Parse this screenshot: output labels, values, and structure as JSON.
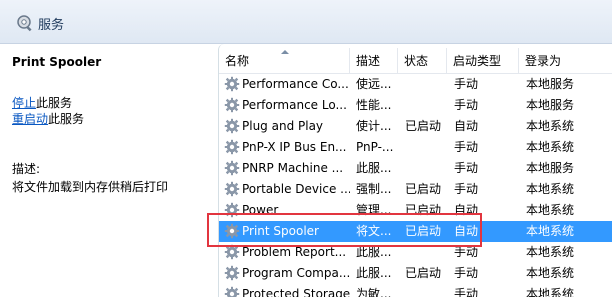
{
  "header": {
    "title": "服务"
  },
  "detail": {
    "service_name": "Print Spooler",
    "stop_link": "停止",
    "stop_suffix": "此服务",
    "restart_link": "重启动",
    "restart_suffix": "此服务",
    "description_label": "描述:",
    "description_text": "将文件加载到内存供稍后打印"
  },
  "columns": {
    "name": "名称",
    "description": "描述",
    "status": "状态",
    "startup_type": "启动类型",
    "logon_as": "登录为"
  },
  "rows": [
    {
      "name": "Performance Co...",
      "description": "使远...",
      "status": "",
      "startup": "手动",
      "logon": "本地服务",
      "selected": false
    },
    {
      "name": "Performance Lo...",
      "description": "性能...",
      "status": "",
      "startup": "手动",
      "logon": "本地服务",
      "selected": false
    },
    {
      "name": "Plug and Play",
      "description": "使计...",
      "status": "已启动",
      "startup": "自动",
      "logon": "本地系统",
      "selected": false
    },
    {
      "name": "PnP-X IP Bus En...",
      "description": "PnP-...",
      "status": "",
      "startup": "手动",
      "logon": "本地系统",
      "selected": false
    },
    {
      "name": "PNRP Machine ...",
      "description": "此服...",
      "status": "",
      "startup": "手动",
      "logon": "本地服务",
      "selected": false
    },
    {
      "name": "Portable Device ...",
      "description": "强制...",
      "status": "已启动",
      "startup": "手动",
      "logon": "本地系统",
      "selected": false
    },
    {
      "name": "Power",
      "description": "管理...",
      "status": "已启动",
      "startup": "自动",
      "logon": "本地系统",
      "selected": false
    },
    {
      "name": "Print Spooler",
      "description": "将文...",
      "status": "已启动",
      "startup": "自动",
      "logon": "本地系统",
      "selected": true
    },
    {
      "name": "Problem Report...",
      "description": "此服...",
      "status": "",
      "startup": "手动",
      "logon": "本地系统",
      "selected": false
    },
    {
      "name": "Program Compa...",
      "description": "此服...",
      "status": "已启动",
      "startup": "手动",
      "logon": "本地系统",
      "selected": false
    },
    {
      "name": "Protected Storage",
      "description": "为敏...",
      "status": "",
      "startup": "手动",
      "logon": "本地系统",
      "selected": false
    }
  ],
  "icons": {
    "header": "services-icon",
    "row": "gear-icon"
  },
  "colors": {
    "selection": "#3399ff",
    "highlight_border": "#e2353f",
    "link": "#0a58c2"
  }
}
